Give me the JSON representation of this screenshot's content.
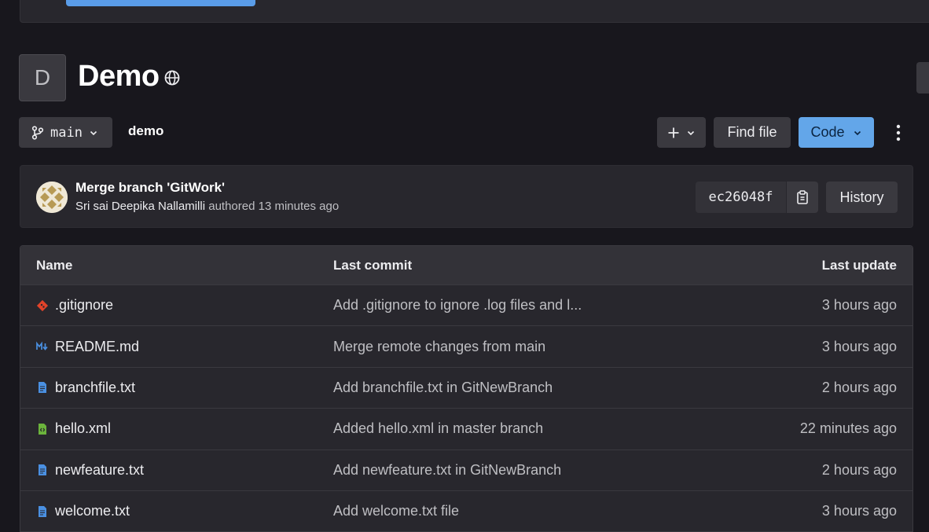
{
  "project": {
    "avatar_letter": "D",
    "title": "Demo",
    "visibility_icon": "globe-icon"
  },
  "toolbar": {
    "branch": "main",
    "breadcrumb": "demo",
    "add_icon": "plus-icon",
    "find_file_label": "Find file",
    "code_label": "Code"
  },
  "last_commit": {
    "title": "Merge branch 'GitWork'",
    "author": "Sri sai Deepika Nallamilli",
    "action_time": "authored 13 minutes ago",
    "sha": "ec26048f",
    "history_label": "History"
  },
  "table": {
    "headers": {
      "name": "Name",
      "last_commit": "Last commit",
      "last_update": "Last update"
    },
    "rows": [
      {
        "name": ".gitignore",
        "icon": "git-icon",
        "commit": "Add .gitignore to ignore .log files and l...",
        "updated": "3 hours ago"
      },
      {
        "name": "README.md",
        "icon": "markdown-icon",
        "commit": "Merge remote changes from main",
        "updated": "3 hours ago"
      },
      {
        "name": "branchfile.txt",
        "icon": "text-file-icon",
        "commit": "Add branchfile.txt in GitNewBranch",
        "updated": "2 hours ago"
      },
      {
        "name": "hello.xml",
        "icon": "xml-file-icon",
        "commit": "Added hello.xml in master branch",
        "updated": "22 minutes ago"
      },
      {
        "name": "newfeature.txt",
        "icon": "text-file-icon",
        "commit": "Add newfeature.txt in GitNewBranch",
        "updated": "2 hours ago"
      },
      {
        "name": "welcome.txt",
        "icon": "text-file-icon",
        "commit": "Add welcome.txt file",
        "updated": "3 hours ago"
      }
    ]
  },
  "colors": {
    "background": "#18171d",
    "panel": "#28272d",
    "button": "#3a393f",
    "accent_blue": "#63a6e9",
    "git_orange": "#e24329",
    "xml_green": "#6bb33c",
    "text_file_blue": "#4a90e2"
  }
}
